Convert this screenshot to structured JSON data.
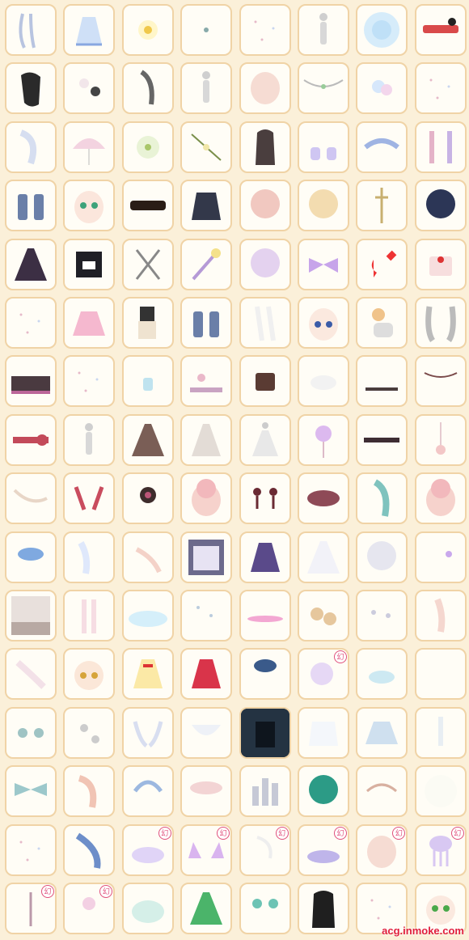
{
  "watermark": "acg.inmoke.com",
  "grid": {
    "columns": 8,
    "rows": 16
  },
  "badge_label": "幻",
  "items": [
    {
      "icon": "hair-strands-icon",
      "badge": false
    },
    {
      "icon": "lace-dress-icon",
      "badge": false
    },
    {
      "icon": "flower-bow-icon",
      "badge": false
    },
    {
      "icon": "small-charm-icon",
      "badge": false
    },
    {
      "icon": "sparkle-dots-icon",
      "badge": false
    },
    {
      "icon": "figure-icon",
      "badge": false
    },
    {
      "icon": "blue-halo-icon",
      "badge": false
    },
    {
      "icon": "ribbon-pin-icon",
      "badge": false
    },
    {
      "icon": "long-black-hair-icon",
      "badge": false
    },
    {
      "icon": "floral-branch-icon",
      "badge": false
    },
    {
      "icon": "grey-hair-icon",
      "badge": false
    },
    {
      "icon": "figure-icon",
      "badge": false
    },
    {
      "icon": "face-base-icon",
      "badge": false
    },
    {
      "icon": "garland-icon",
      "badge": false
    },
    {
      "icon": "rose-cluster-icon",
      "badge": false
    },
    {
      "icon": "sparkle-dots-icon",
      "badge": false
    },
    {
      "icon": "white-hair-icon",
      "badge": false
    },
    {
      "icon": "umbrella-icon",
      "badge": false
    },
    {
      "icon": "pinwheel-icon",
      "badge": false
    },
    {
      "icon": "flower-sprig-icon",
      "badge": false
    },
    {
      "icon": "dark-hair-icon",
      "badge": false
    },
    {
      "icon": "shoes-icon",
      "badge": false
    },
    {
      "icon": "bow-headband-icon",
      "badge": false
    },
    {
      "icon": "curtain-icon",
      "badge": false
    },
    {
      "icon": "boots-icon",
      "badge": false
    },
    {
      "icon": "green-eyes-icon",
      "badge": false
    },
    {
      "icon": "black-hat-icon",
      "badge": false
    },
    {
      "icon": "sweater-icon",
      "badge": false
    },
    {
      "icon": "pink-bob-hair-icon",
      "badge": false
    },
    {
      "icon": "blonde-hair-icon",
      "badge": false
    },
    {
      "icon": "cross-stand-icon",
      "badge": false
    },
    {
      "icon": "navy-hair-icon",
      "badge": false
    },
    {
      "icon": "dark-gown-icon",
      "badge": false
    },
    {
      "icon": "dark-frame-icon",
      "badge": false
    },
    {
      "icon": "scissors-icon",
      "badge": false
    },
    {
      "icon": "star-wand-icon",
      "badge": false
    },
    {
      "icon": "lilac-hair-icon",
      "badge": false
    },
    {
      "icon": "purple-bow-icon",
      "badge": false
    },
    {
      "icon": "card-suits-icon",
      "badge": false
    },
    {
      "icon": "cake-icon",
      "badge": false
    },
    {
      "icon": "sparkle-dots-icon",
      "badge": false
    },
    {
      "icon": "pink-skirt-icon",
      "badge": false
    },
    {
      "icon": "book-scarf-icon",
      "badge": false
    },
    {
      "icon": "boots-icon",
      "badge": false
    },
    {
      "icon": "white-legs-icon",
      "badge": false
    },
    {
      "icon": "blue-eyes-face-icon",
      "badge": false
    },
    {
      "icon": "cat-companion-icon",
      "badge": false
    },
    {
      "icon": "braid-hair-icon",
      "badge": false
    },
    {
      "icon": "stage-icon",
      "badge": false
    },
    {
      "icon": "sparkle-dots-icon",
      "badge": false
    },
    {
      "icon": "perfume-icon",
      "badge": false
    },
    {
      "icon": "flower-bed-icon",
      "badge": false
    },
    {
      "icon": "choco-cake-icon",
      "badge": false
    },
    {
      "icon": "cloud-icon",
      "badge": false
    },
    {
      "icon": "silhouette-icon",
      "badge": false
    },
    {
      "icon": "chandelier-icon",
      "badge": false
    },
    {
      "icon": "heart-belt-icon",
      "badge": false
    },
    {
      "icon": "figure-icon",
      "badge": false
    },
    {
      "icon": "brown-gown-icon",
      "badge": false
    },
    {
      "icon": "pale-gown-icon",
      "badge": false
    },
    {
      "icon": "figure-gown-icon",
      "badge": false
    },
    {
      "icon": "lollipop-icon",
      "badge": false
    },
    {
      "icon": "dark-lace-icon",
      "badge": false
    },
    {
      "icon": "pendant-icon",
      "badge": false
    },
    {
      "icon": "pearl-vine-icon",
      "badge": false
    },
    {
      "icon": "red-ribbon-icon",
      "badge": false
    },
    {
      "icon": "dark-flowers-icon",
      "badge": false
    },
    {
      "icon": "pink-face-icon",
      "badge": false
    },
    {
      "icon": "earrings-icon",
      "badge": false
    },
    {
      "icon": "rose-crown-icon",
      "badge": false
    },
    {
      "icon": "teal-hair-icon",
      "badge": false
    },
    {
      "icon": "pink-face-icon",
      "badge": false
    },
    {
      "icon": "blue-cloud-icon",
      "badge": false
    },
    {
      "icon": "gloves-icon",
      "badge": false
    },
    {
      "icon": "heels-icon",
      "badge": false
    },
    {
      "icon": "window-scene-icon",
      "badge": false
    },
    {
      "icon": "plaid-dress-icon",
      "badge": false
    },
    {
      "icon": "white-gown-icon",
      "badge": false
    },
    {
      "icon": "silver-hair-icon",
      "badge": false
    },
    {
      "icon": "small-flower-icon",
      "badge": false
    },
    {
      "icon": "room-scene-icon",
      "badge": false
    },
    {
      "icon": "legs-icon",
      "badge": false
    },
    {
      "icon": "ice-plate-icon",
      "badge": false
    },
    {
      "icon": "petals-icon",
      "badge": false
    },
    {
      "icon": "pink-glow-icon",
      "badge": false
    },
    {
      "icon": "pets-icon",
      "badge": false
    },
    {
      "icon": "snowflakes-icon",
      "badge": false
    },
    {
      "icon": "arm-pose-icon",
      "badge": false
    },
    {
      "icon": "sleeve-icon",
      "badge": false
    },
    {
      "icon": "amber-eyes-icon",
      "badge": false
    },
    {
      "icon": "yellow-dress-icon",
      "badge": false
    },
    {
      "icon": "red-dress-icon",
      "badge": false
    },
    {
      "icon": "beret-icon",
      "badge": false
    },
    {
      "icon": "bear-icon",
      "badge": true
    },
    {
      "icon": "teacup-icon",
      "badge": false
    },
    {
      "icon": "empty-icon",
      "badge": false
    },
    {
      "icon": "blue-flowers-icon",
      "badge": false
    },
    {
      "icon": "white-flowers-icon",
      "badge": false
    },
    {
      "icon": "wings-icon",
      "badge": false
    },
    {
      "icon": "lace-collar-icon",
      "badge": false
    },
    {
      "icon": "dark-forest-icon",
      "badge": false
    },
    {
      "icon": "white-blouse-icon",
      "badge": false
    },
    {
      "icon": "blue-skirt-icon",
      "badge": false
    },
    {
      "icon": "sock-icon",
      "badge": false
    },
    {
      "icon": "teal-bow-icon",
      "badge": false
    },
    {
      "icon": "peach-hair-icon",
      "badge": false
    },
    {
      "icon": "blue-bonnet-icon",
      "badge": false
    },
    {
      "icon": "pink-hat-icon",
      "badge": false
    },
    {
      "icon": "city-icon",
      "badge": false
    },
    {
      "icon": "green-hair-icon",
      "badge": false
    },
    {
      "icon": "jewel-crown-icon",
      "badge": false
    },
    {
      "icon": "white-glow-icon",
      "badge": false
    },
    {
      "icon": "sparkle-dots-icon",
      "badge": false
    },
    {
      "icon": "feather-icon",
      "badge": false
    },
    {
      "icon": "lavender-cloud-icon",
      "badge": true
    },
    {
      "icon": "cat-ears-icon",
      "badge": true
    },
    {
      "icon": "feather-pin-icon",
      "badge": true
    },
    {
      "icon": "purple-cloud-icon",
      "badge": true
    },
    {
      "icon": "face-icon",
      "badge": true
    },
    {
      "icon": "jellyfish-icon",
      "badge": true
    },
    {
      "icon": "wand-icon",
      "badge": true
    },
    {
      "icon": "pink-fairy-icon",
      "badge": true
    },
    {
      "icon": "mint-mist-icon",
      "badge": false
    },
    {
      "icon": "green-gown-icon",
      "badge": false
    },
    {
      "icon": "ribbon-clips-icon",
      "badge": false
    },
    {
      "icon": "black-hair-icon",
      "badge": false
    },
    {
      "icon": "sparkle-dots-icon",
      "badge": false
    },
    {
      "icon": "green-eyes-face-icon",
      "badge": false
    }
  ]
}
